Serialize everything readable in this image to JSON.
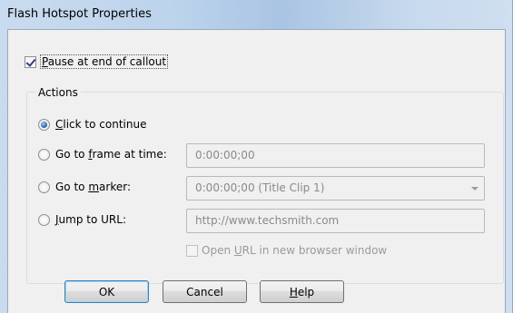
{
  "window": {
    "title": "Flash Hotspot Properties"
  },
  "pause_option": {
    "checked": true,
    "label_before": "",
    "label_mnemonic": "P",
    "label_after": "ause at end of callout"
  },
  "actions": {
    "legend": "Actions",
    "options": [
      {
        "mnemonic": "C",
        "before": "",
        "after": "lick to continue",
        "selected": true
      },
      {
        "before": "Go to ",
        "mnemonic": "f",
        "after": "rame at time:",
        "selected": false,
        "field_value": "0:00:00;00"
      },
      {
        "before": "Go to ",
        "mnemonic": "m",
        "after": "arker:",
        "selected": false,
        "field_value": "0:00:00;00 (Title Clip 1)"
      },
      {
        "before": "",
        "mnemonic": "J",
        "after": "ump to URL:",
        "selected": false,
        "field_value": "http://www.techsmith.com"
      }
    ],
    "open_new_window": {
      "checked": false,
      "before": "Open ",
      "mnemonic": "U",
      "after": "RL in new browser window"
    }
  },
  "buttons": {
    "ok": "OK",
    "cancel": "Cancel",
    "help_mnemonic": "H",
    "help_rest": "elp"
  }
}
